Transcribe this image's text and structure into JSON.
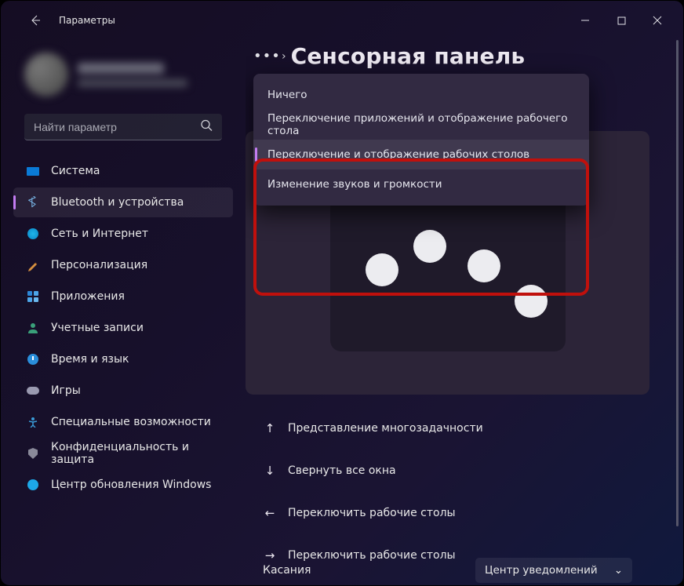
{
  "titlebar": {
    "title": "Параметры"
  },
  "search": {
    "placeholder": "Найти параметр"
  },
  "nav": {
    "items": [
      {
        "label": "Система"
      },
      {
        "label": "Bluetooth и устройства"
      },
      {
        "label": "Сеть и Интернет"
      },
      {
        "label": "Персонализация"
      },
      {
        "label": "Приложения"
      },
      {
        "label": "Учетные записи"
      },
      {
        "label": "Время и язык"
      },
      {
        "label": "Игры"
      },
      {
        "label": "Специальные возможности"
      },
      {
        "label": "Конфиденциальность и защита"
      },
      {
        "label": "Центр обновления Windows"
      }
    ]
  },
  "page": {
    "title": "Сенсорная панель"
  },
  "dropdown": {
    "items": [
      {
        "label": "Ничего"
      },
      {
        "label": "Переключение приложений и отображение рабочего стола"
      },
      {
        "label": "Переключение и отображение рабочих столов"
      },
      {
        "label": "Изменение звуков и громкости"
      }
    ]
  },
  "gestures": {
    "rows": [
      {
        "icon": "↑",
        "label": "Представление многозадачности"
      },
      {
        "icon": "↓",
        "label": "Свернуть все окна"
      },
      {
        "icon": "←",
        "label": "Переключить рабочие столы"
      },
      {
        "icon": "→",
        "label": "Переключить рабочие столы"
      }
    ]
  },
  "bottom": {
    "label": "Касания",
    "select": "Центр уведомлений"
  }
}
